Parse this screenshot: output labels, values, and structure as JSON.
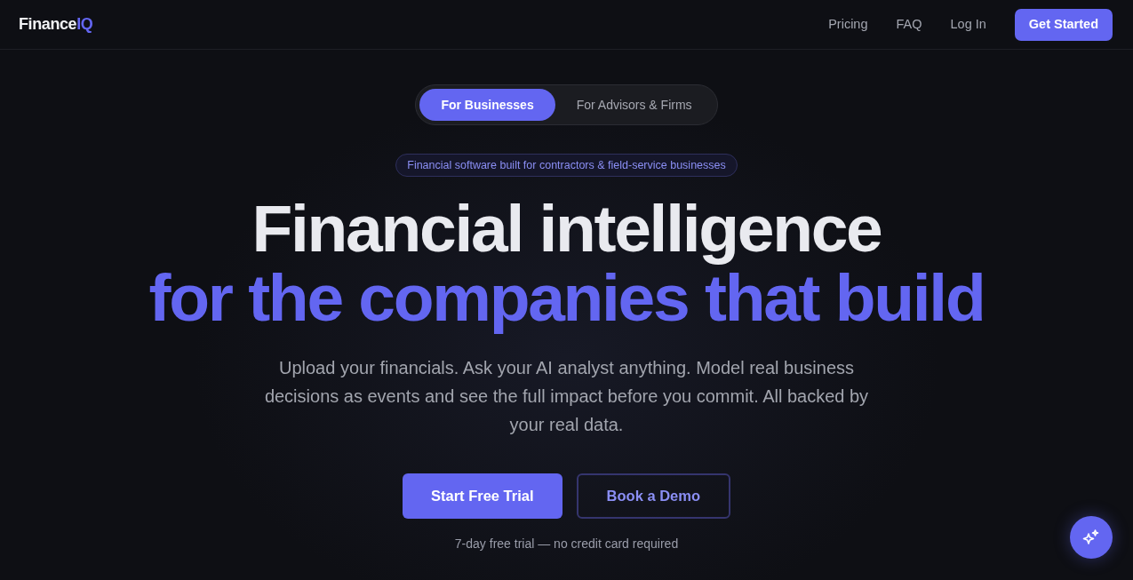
{
  "navbar": {
    "logo": {
      "text": "Finance",
      "accent": "IQ"
    },
    "links": [
      "Pricing",
      "FAQ",
      "Log In"
    ],
    "cta": "Get Started"
  },
  "audience_toggle": [
    {
      "label": "For Businesses",
      "selected": true
    },
    {
      "label": "For Advisors & Firms",
      "selected": false
    }
  ],
  "hero": {
    "badge": "Financial software built for contractors & field-service businesses",
    "headline": "Financial intelligence",
    "headline_accent": "for the companies that build",
    "subtitle": "Upload your financials. Ask your AI analyst anything. Model real business decisions as events and see the full impact before you commit. All backed by your real data.",
    "buttons": [
      {
        "label": "Start Free Trial",
        "kind": "primary"
      },
      {
        "label": "Book a Demo",
        "kind": "outline"
      }
    ],
    "note": "7-day free trial — no credit card required"
  }
}
